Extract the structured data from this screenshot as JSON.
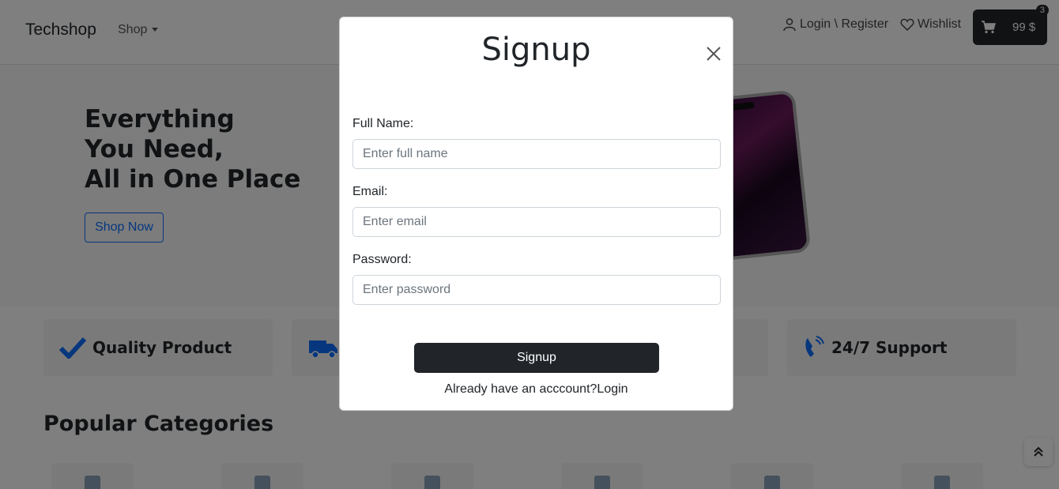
{
  "navbar": {
    "brand": "Techshop",
    "shop_menu": "Shop",
    "login_register": "Login \\ Register",
    "wishlist": "Wishlist",
    "cart_total": "99 $",
    "cart_count": "3"
  },
  "hero": {
    "title_lines": [
      "Everything",
      "You Need,",
      "All in One Place"
    ],
    "cta": "Shop Now"
  },
  "features": {
    "items": [
      "Quality Product",
      "",
      "",
      "24/7 Support"
    ]
  },
  "popular": {
    "title": "Popular Categories"
  },
  "modal": {
    "title": "Signup",
    "fields": [
      {
        "label": "Full Name:",
        "placeholder": "Enter full name"
      },
      {
        "label": "Email:",
        "placeholder": "Enter email"
      },
      {
        "label": "Password:",
        "placeholder": "Enter password"
      }
    ],
    "submit": "Signup",
    "already_text": "Already have an acccount?",
    "login_link": "Login"
  },
  "colors": {
    "primary": "#0d6efd",
    "dark": "#212529",
    "backdrop": "rgba(0,0,0,0.5)"
  }
}
